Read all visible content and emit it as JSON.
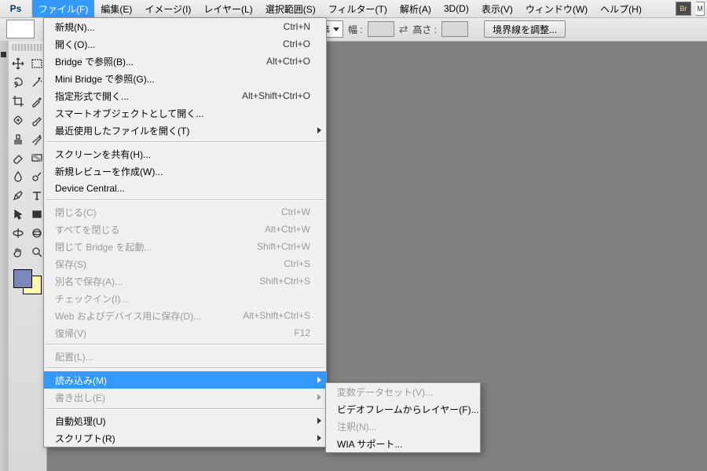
{
  "app": {
    "logo": "Ps"
  },
  "menubar": {
    "items": [
      {
        "label": "ファイル(F)",
        "open": true
      },
      {
        "label": "編集(E)"
      },
      {
        "label": "イメージ(I)"
      },
      {
        "label": "レイヤー(L)"
      },
      {
        "label": "選択範囲(S)"
      },
      {
        "label": "フィルター(T)"
      },
      {
        "label": "解析(A)"
      },
      {
        "label": "3D(D)"
      },
      {
        "label": "表示(V)"
      },
      {
        "label": "ウィンドウ(W)"
      },
      {
        "label": "ヘルプ(H)"
      }
    ],
    "badges": {
      "br": "Br",
      "mb": "M"
    }
  },
  "optionsbar": {
    "combo_text": "準",
    "width_label": "幅 :",
    "height_label": "高さ :",
    "button_label": "境界線を調整..."
  },
  "toolbox": {
    "rows": [
      [
        "move",
        "marquee-rect"
      ],
      [
        "lasso",
        "magic-wand"
      ],
      [
        "crop",
        "eyedropper"
      ],
      [
        "healing",
        "brush"
      ],
      [
        "stamp",
        "history-brush"
      ],
      [
        "eraser",
        "gradient"
      ],
      [
        "blur",
        "dodge"
      ],
      [
        "pen",
        "type"
      ],
      [
        "path-select",
        "rectangle-shape"
      ],
      [
        "3d-rotate",
        "3d-orbit"
      ],
      [
        "hand",
        "zoom"
      ]
    ],
    "swatch_front": "#7a87b8",
    "swatch_back": "#fefcaa"
  },
  "file_menu": {
    "groups": [
      [
        {
          "label": "新規(N)...",
          "shortcut": "Ctrl+N"
        },
        {
          "label": "開く(O)...",
          "shortcut": "Ctrl+O"
        },
        {
          "label": "Bridge で参照(B)...",
          "shortcut": "Alt+Ctrl+O"
        },
        {
          "label": "Mini Bridge で参照(G)..."
        },
        {
          "label": "指定形式で開く...",
          "shortcut": "Alt+Shift+Ctrl+O"
        },
        {
          "label": "スマートオブジェクトとして開く..."
        },
        {
          "label": "最近使用したファイルを開く(T)",
          "submenu": true
        }
      ],
      [
        {
          "label": "スクリーンを共有(H)..."
        },
        {
          "label": "新規レビューを作成(W)..."
        },
        {
          "label": "Device Central..."
        }
      ],
      [
        {
          "label": "閉じる(C)",
          "shortcut": "Ctrl+W",
          "disabled": true
        },
        {
          "label": "すべてを閉じる",
          "shortcut": "Alt+Ctrl+W",
          "disabled": true
        },
        {
          "label": "閉じて Bridge を起動...",
          "shortcut": "Shift+Ctrl+W",
          "disabled": true
        },
        {
          "label": "保存(S)",
          "shortcut": "Ctrl+S",
          "disabled": true
        },
        {
          "label": "別名で保存(A)...",
          "shortcut": "Shift+Ctrl+S",
          "disabled": true
        },
        {
          "label": "チェックイン(I)...",
          "disabled": true
        },
        {
          "label": "Web およびデバイス用に保存(D)...",
          "shortcut": "Alt+Shift+Ctrl+S",
          "disabled": true
        },
        {
          "label": "復帰(V)",
          "shortcut": "F12",
          "disabled": true
        }
      ],
      [
        {
          "label": "配置(L)...",
          "disabled": true
        }
      ],
      [
        {
          "label": "読み込み(M)",
          "submenu": true,
          "highlight": true
        },
        {
          "label": "書き出し(E)",
          "submenu": true,
          "disabled": true
        }
      ],
      [
        {
          "label": "自動処理(U)",
          "submenu": true
        },
        {
          "label": "スクリプト(R)",
          "submenu": true
        }
      ]
    ]
  },
  "import_submenu": {
    "items": [
      {
        "label": "変数データセット(V)...",
        "disabled": true
      },
      {
        "label": "ビデオフレームからレイヤー(F)..."
      },
      {
        "label": "注釈(N)...",
        "disabled": true
      },
      {
        "label": "WIA サポート..."
      }
    ]
  }
}
